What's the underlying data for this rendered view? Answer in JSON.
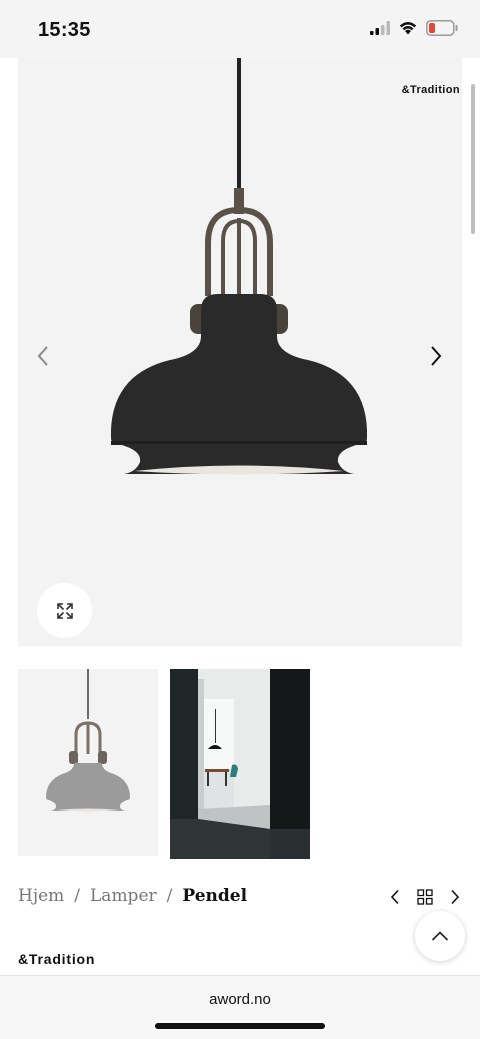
{
  "status_bar": {
    "time": "15:35",
    "icons": [
      "signal-icon",
      "wifi-icon",
      "battery-low-icon"
    ],
    "battery_color": "#e5463c"
  },
  "hero": {
    "brand_logo": "&Tradition",
    "background_color": "#f3f3f3",
    "lamp_color": "#2a2a2a",
    "hardware_color": "#5b5247",
    "prev_icon": "chevron-left-icon",
    "next_icon": "chevron-right-icon",
    "expand_icon": "expand-icon"
  },
  "thumbnails": [
    {
      "name": "grey-lamp-thumbnail"
    },
    {
      "name": "interior-room-thumbnail"
    }
  ],
  "breadcrumb": {
    "items": [
      "Hjem",
      "Lamper",
      "Pendel"
    ],
    "separator": "/"
  },
  "nav_controls": {
    "prev_icon": "chevron-left-icon",
    "grid_icon": "grid-icon",
    "next_icon": "chevron-right-icon"
  },
  "scroll_top_icon": "chevron-up-icon",
  "brand": {
    "name": "&Tradition"
  },
  "browser": {
    "url": "aword.no"
  }
}
